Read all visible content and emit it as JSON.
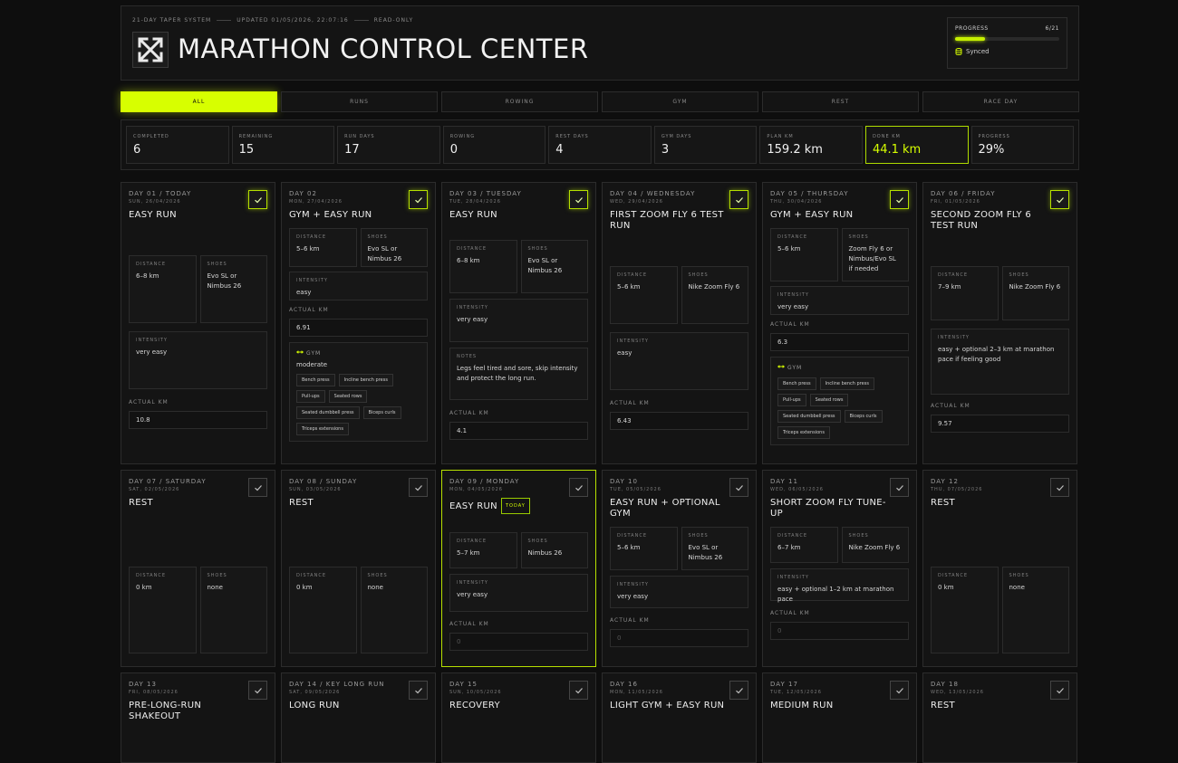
{
  "header": {
    "system": "21-DAY TAPER SYSTEM",
    "updated": "UPDATED 01/05/2026, 22:07:16",
    "mode": "READ-ONLY",
    "title": "MARATHON CONTROL CENTER",
    "progress_label": "PROGRESS",
    "progress_count": "6/21",
    "progress_fraction": 0.29,
    "sync_status": "Synced",
    "logo_icon": "expand-arrows-icon"
  },
  "tabs": [
    "ALL",
    "RUNS",
    "ROWING",
    "GYM",
    "REST",
    "RACE DAY"
  ],
  "active_tab": 0,
  "stats": [
    {
      "label": "COMPLETED",
      "value": "6"
    },
    {
      "label": "REMAINING",
      "value": "15"
    },
    {
      "label": "RUN DAYS",
      "value": "17"
    },
    {
      "label": "ROWING",
      "value": "0"
    },
    {
      "label": "REST DAYS",
      "value": "4"
    },
    {
      "label": "GYM DAYS",
      "value": "3"
    },
    {
      "label": "PLAN KM",
      "value": "159.2 km"
    },
    {
      "label": "DONE KM",
      "value": "44.1 km"
    },
    {
      "label": "PROGRESS",
      "value": "29%"
    }
  ],
  "labels": {
    "distance": "DISTANCE",
    "shoes": "SHOES",
    "intensity": "INTENSITY",
    "actual_km": "ACTUAL KM",
    "notes": "NOTES",
    "gym": "GYM",
    "today_badge": "TODAY",
    "empty_km": "0"
  },
  "colors": {
    "accent": "#d7ff00",
    "bg": "#0e0e0e",
    "card": "#141414"
  },
  "cards_row1": [
    {
      "day": "DAY 01 / TODAY",
      "date": "SUN, 26/04/2026",
      "title": "EASY RUN",
      "distance": "6–8 km",
      "shoes": "Evo SL or Nimbus 26",
      "intensity": "very easy",
      "actual": "10.8",
      "done": true
    },
    {
      "day": "DAY 02",
      "date": "MON, 27/04/2026",
      "title": "GYM + EASY RUN",
      "distance": "5–6 km",
      "shoes": "Evo SL or Nimbus 26",
      "intensity": "easy",
      "actual": "6.91",
      "gym": "moderate",
      "exercises": [
        "Bench press",
        "Incline bench press",
        "Pull-ups",
        "Seated rows",
        "Seated dumbbell press",
        "Biceps curls",
        "Triceps extensions"
      ],
      "done": true
    },
    {
      "day": "DAY 03 / TUESDAY",
      "date": "TUE, 28/04/2026",
      "title": "EASY RUN",
      "distance": "6–8 km",
      "shoes": "Evo SL or Nimbus 26",
      "intensity": "very easy",
      "notes": "Legs feel tired and sore, skip intensity and protect the long run.",
      "actual": "4.1",
      "done": true
    },
    {
      "day": "DAY 04 / WEDNESDAY",
      "date": "WED, 29/04/2026",
      "title": "FIRST ZOOM FLY 6 TEST RUN",
      "distance": "5–6 km",
      "shoes": "Nike Zoom Fly 6",
      "intensity": "easy",
      "actual": "6.43",
      "done": true
    },
    {
      "day": "DAY 05 / THURSDAY",
      "date": "THU, 30/04/2026",
      "title": "GYM + EASY RUN",
      "distance": "5–6 km",
      "shoes": "Zoom Fly 6 or Nimbus/Evo SL if needed",
      "intensity": "very easy",
      "actual": "6.3",
      "gym": "",
      "exercises": [
        "Bench press",
        "Incline bench press",
        "Pull-ups",
        "Seated rows",
        "Seated dumbbell press",
        "Biceps curls",
        "Triceps extensions"
      ],
      "done": true
    },
    {
      "day": "DAY 06 / FRIDAY",
      "date": "FRI, 01/05/2026",
      "title": "SECOND ZOOM FLY 6 TEST RUN",
      "distance": "7–9 km",
      "shoes": "Nike Zoom Fly 6",
      "intensity": "easy + optional 2–3 km at marathon pace if feeling good",
      "actual": "9.57",
      "done": true
    }
  ],
  "cards_row2": [
    {
      "day": "DAY 07 / SATURDAY",
      "date": "SAT, 02/05/2026",
      "title": "REST",
      "distance": "0 km",
      "shoes": "none"
    },
    {
      "day": "DAY 08 / SUNDAY",
      "date": "SUN, 03/05/2026",
      "title": "REST",
      "distance": "0 km",
      "shoes": "none"
    },
    {
      "day": "DAY 09 / MONDAY",
      "date": "MON, 04/05/2026",
      "title": "EASY RUN",
      "distance": "5–7 km",
      "shoes": "Nimbus 26",
      "intensity": "very easy"
    },
    {
      "day": "DAY 10",
      "date": "TUE, 05/05/2026",
      "title": "EASY RUN + OPTIONAL GYM",
      "distance": "5–6 km",
      "shoes": "Evo SL or Nimbus 26",
      "intensity": "very easy"
    },
    {
      "day": "DAY 11",
      "date": "WED, 06/05/2026",
      "title": "SHORT ZOOM FLY TUNE-UP",
      "distance": "6–7 km",
      "shoes": "Nike Zoom Fly 6",
      "intensity": "easy + optional 1–2 km at marathon pace"
    },
    {
      "day": "DAY 12",
      "date": "THU, 07/05/2026",
      "title": "REST",
      "distance": "0 km",
      "shoes": "none"
    }
  ],
  "cards_row3": [
    {
      "day": "DAY 13",
      "date": "FRI, 08/05/2026",
      "title": "PRE-LONG-RUN SHAKEOUT"
    },
    {
      "day": "DAY 14 / KEY LONG RUN",
      "date": "SAT, 09/05/2026",
      "title": "LONG RUN"
    },
    {
      "day": "DAY 15",
      "date": "SUN, 10/05/2026",
      "title": "RECOVERY"
    },
    {
      "day": "DAY 16",
      "date": "MON, 11/05/2026",
      "title": "LIGHT GYM + EASY RUN"
    },
    {
      "day": "DAY 17",
      "date": "TUE, 12/05/2026",
      "title": "MEDIUM RUN"
    },
    {
      "day": "DAY 18",
      "date": "WED, 13/05/2026",
      "title": "REST"
    }
  ]
}
